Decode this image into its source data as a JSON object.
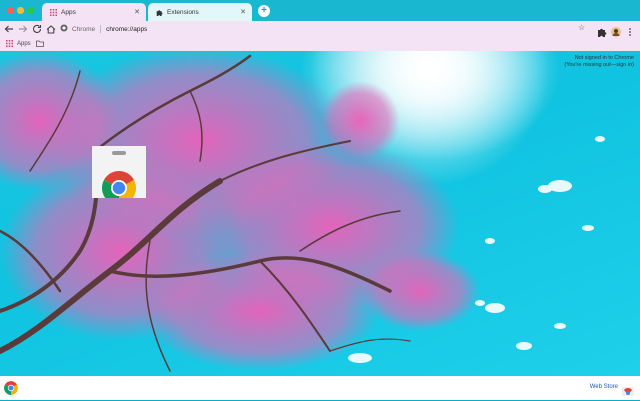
{
  "window": {
    "colors": {
      "close": "#fe5f57",
      "minimize": "#febc2e",
      "zoom": "#28c840",
      "frame": "#19b7d0",
      "toolbar": "#f4e3f4"
    }
  },
  "tabs": [
    {
      "label": "Apps",
      "icon": "apps-grid-icon",
      "active": true
    },
    {
      "label": "Extensions",
      "icon": "puzzle-icon",
      "active": false
    }
  ],
  "toolbar": {
    "site_label": "Chrome",
    "url": "chrome://apps"
  },
  "bookmarks": {
    "apps_label": "Apps",
    "folder_icon": "folder-icon"
  },
  "content": {
    "signin_line1": "Not signed in to Chrome",
    "signin_line2": "(You're missing out—sign in)",
    "app_tile_name": "web-store-app-icon"
  },
  "footer": {
    "webstore_label": "Web Store"
  }
}
